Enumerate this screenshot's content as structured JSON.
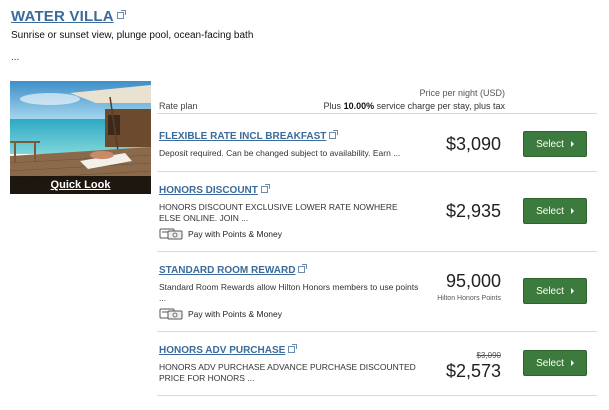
{
  "room": {
    "title": "WATER VILLA",
    "description": "Sunrise or sunset view, plunge pool, ocean-facing bath",
    "more": "...",
    "quick_look": "Quick Look"
  },
  "table_header": {
    "rate_plan": "Rate plan",
    "price_per_night": "Price per night (USD)",
    "service_charge_prefix": "Plus ",
    "service_charge_percent": "10.00%",
    "service_charge_suffix": " service charge per stay, plus tax"
  },
  "rates": [
    {
      "name": "FLEXIBLE RATE INCL BREAKFAST",
      "description": "Deposit required. Can be changed subject to availability. Earn ...",
      "price": "$3,090",
      "button": "Select"
    },
    {
      "name": "HONORS DISCOUNT",
      "description": "HONORS DISCOUNT EXCLUSIVE LOWER RATE NOWHERE ELSE ONLINE. JOIN ...",
      "pay_option": "Pay with Points & Money",
      "price": "$2,935",
      "button": "Select"
    },
    {
      "name": "STANDARD ROOM REWARD",
      "description": "Standard Room Rewards allow Hilton Honors members to use points ...",
      "pay_option": "Pay with Points & Money",
      "price": "95,000",
      "price_sub": "Hilton Honors Points",
      "button": "Select"
    },
    {
      "name": "HONORS ADV PURCHASE",
      "description": "HONORS ADV PURCHASE ADVANCE PURCHASE DISCOUNTED PRICE FOR HONORS ...",
      "price_old": "$3,090",
      "price": "$2,573",
      "button": "Select"
    }
  ],
  "colors": {
    "link": "#3a6b9a",
    "button": "#3d7a3d"
  }
}
